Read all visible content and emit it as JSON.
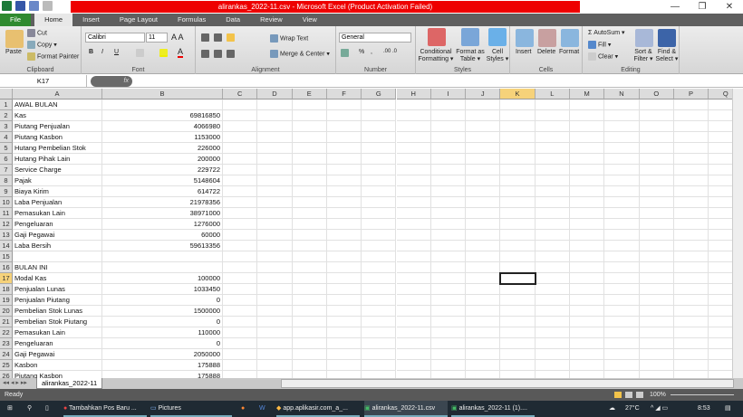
{
  "window": {
    "title": "alirankas_2022-11.csv  -  Microsoft Excel (Product Activation Failed)",
    "minimize": "—",
    "restore": "❐",
    "close": "✕"
  },
  "tabs": [
    "File",
    "Home",
    "Insert",
    "Page Layout",
    "Formulas",
    "Data",
    "Review",
    "View"
  ],
  "ribbon": {
    "clipboard": {
      "label": "Clipboard",
      "paste": "Paste",
      "cut": "Cut",
      "copy": "Copy ▾",
      "format_painter": "Format Painter"
    },
    "font": {
      "label": "Font",
      "name": "Calibri",
      "size": "11",
      "bold": "B",
      "italic": "I",
      "underline": "U"
    },
    "alignment": {
      "label": "Alignment",
      "wrap": "Wrap Text",
      "merge": "Merge & Center ▾"
    },
    "number": {
      "label": "Number",
      "format": "General",
      "percent": "%",
      "comma": ","
    },
    "styles": {
      "label": "Styles",
      "conditional": "Conditional Formatting ▾",
      "format_table": "Format as Table ▾",
      "cell_styles": "Cell Styles ▾"
    },
    "cells": {
      "label": "Cells",
      "insert": "Insert",
      "delete": "Delete",
      "format": "Format"
    },
    "editing": {
      "label": "Editing",
      "autosum": "AutoSum ▾",
      "fill": "Fill ▾",
      "clear": "Clear ▾",
      "sort": "Sort & Filter ▾",
      "find": "Find & Select ▾"
    }
  },
  "formula_bar": {
    "name_box": "K17",
    "fx": "fx",
    "value": ""
  },
  "columns": [
    "A",
    "B",
    "C",
    "D",
    "E",
    "F",
    "G",
    "H",
    "I",
    "J",
    "K",
    "L",
    "M",
    "N",
    "O",
    "P",
    "Q"
  ],
  "selected_cell": {
    "col": "K",
    "row": 17
  },
  "rows": [
    {
      "n": 1,
      "a": "AWAL BULAN",
      "b": ""
    },
    {
      "n": 2,
      "a": "Kas",
      "b": "69816850"
    },
    {
      "n": 3,
      "a": "Piutang Penjualan",
      "b": "4066980"
    },
    {
      "n": 4,
      "a": "Piutang Kasbon",
      "b": "1153000"
    },
    {
      "n": 5,
      "a": "Hutang Pembelian Stok",
      "b": "226000"
    },
    {
      "n": 6,
      "a": "Hutang Pihak Lain",
      "b": "200000"
    },
    {
      "n": 7,
      "a": "Service Charge",
      "b": "229722"
    },
    {
      "n": 8,
      "a": "Pajak",
      "b": "5148604"
    },
    {
      "n": 9,
      "a": "Biaya Kirim",
      "b": "614722"
    },
    {
      "n": 10,
      "a": "Laba Penjualan",
      "b": "21978356"
    },
    {
      "n": 11,
      "a": "Pemasukan Lain",
      "b": "38971000"
    },
    {
      "n": 12,
      "a": "Pengeluaran",
      "b": "1276000"
    },
    {
      "n": 13,
      "a": "Gaji Pegawai",
      "b": "60000"
    },
    {
      "n": 14,
      "a": "Laba Bersih",
      "b": "59613356"
    },
    {
      "n": 15,
      "a": "",
      "b": ""
    },
    {
      "n": 16,
      "a": "BULAN INI",
      "b": ""
    },
    {
      "n": 17,
      "a": "Modal Kas",
      "b": "100000"
    },
    {
      "n": 18,
      "a": "Penjualan Lunas",
      "b": "1033450"
    },
    {
      "n": 19,
      "a": "Penjualan Piutang",
      "b": "0"
    },
    {
      "n": 20,
      "a": "Pembelian Stok Lunas",
      "b": "1500000"
    },
    {
      "n": 21,
      "a": "Pembelian Stok Piutang",
      "b": "0"
    },
    {
      "n": 22,
      "a": "Pemasukan Lain",
      "b": "110000"
    },
    {
      "n": 23,
      "a": "Pengeluaran",
      "b": "0"
    },
    {
      "n": 24,
      "a": "Gaji Pegawai",
      "b": "2050000"
    },
    {
      "n": 25,
      "a": "Kasbon",
      "b": "175888"
    },
    {
      "n": 26,
      "a": "Piutang Kasbon",
      "b": "175888"
    }
  ],
  "sheet_tab": "alirankas_2022-11",
  "status": {
    "ready": "Ready",
    "zoom": "100%"
  },
  "taskbar": {
    "items": [
      "Tambahkan Pos Baru ...",
      "Pictures",
      "app.aplikasir.com_a_...",
      "alirankas_2022-11.csv",
      "alirankas_2022-11 (1)...."
    ],
    "temp": "27°C",
    "time": "8:53"
  }
}
